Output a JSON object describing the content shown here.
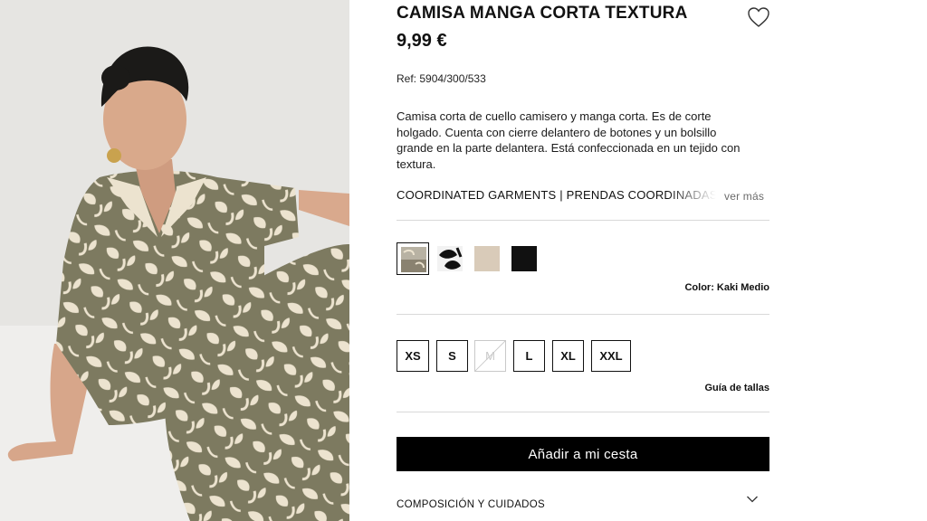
{
  "product": {
    "title": "CAMISA MANGA CORTA TEXTURA",
    "price": "9,99 €",
    "reference": "Ref: 5904/300/533",
    "description": "Camisa corta de cuello camisero y manga corta. Es de corte holgado. Cuenta con cierre delantero de botones y un bolsillo grande en la parte delantera. Está confeccionada en un tejido con textura.",
    "coordinated": "COORDINATED GARMENTS | PRENDAS COORDINADAS",
    "see_more": "ver más"
  },
  "icons": {
    "favorite": "heart-outline-icon",
    "accordion": "chevron-down-icon"
  },
  "colors": {
    "swatches": [
      {
        "name": "kaki-medio",
        "fill": "#8a8270",
        "selected": true
      },
      {
        "name": "black-white-print",
        "fill": "#222222",
        "selected": false
      },
      {
        "name": "beige",
        "fill": "#d9cbb9",
        "selected": false
      },
      {
        "name": "black",
        "fill": "#111111",
        "selected": false
      }
    ],
    "label": "Color:",
    "value": "Kaki Medio"
  },
  "sizes": [
    {
      "label": "XS",
      "available": true
    },
    {
      "label": "S",
      "available": true
    },
    {
      "label": "M",
      "available": false
    },
    {
      "label": "L",
      "available": true
    },
    {
      "label": "XL",
      "available": true
    },
    {
      "label": "XXL",
      "available": true
    }
  ],
  "size_guide": "Guía de tallas",
  "add_to_cart": "Añadir a mi cesta",
  "care_section": "COMPOSICIÓN Y CUIDADOS",
  "theme": {
    "accent": "#000000",
    "print_base": "#7d7a60",
    "print_leaf": "#ece3cf",
    "backdrop": "#e6e5e2"
  }
}
